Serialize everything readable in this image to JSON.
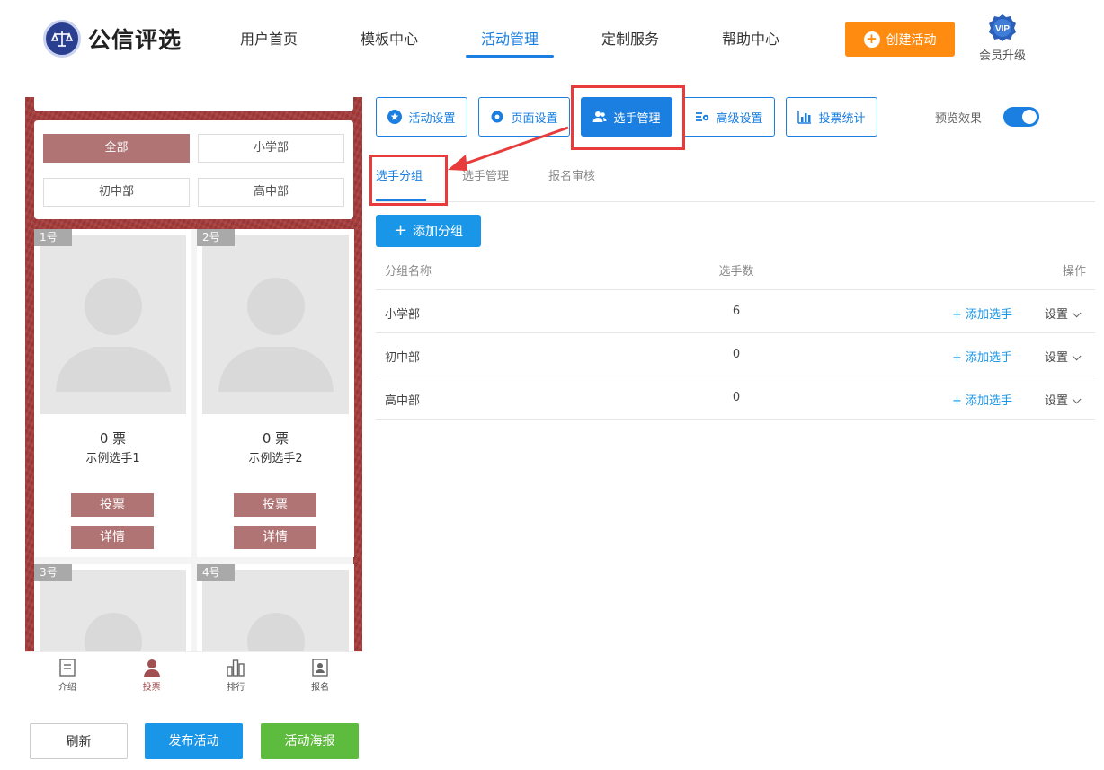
{
  "brand": {
    "name": "公信评选"
  },
  "nav": {
    "items": [
      "用户首页",
      "模板中心",
      "活动管理",
      "定制服务",
      "帮助中心"
    ],
    "active": "活动管理"
  },
  "header": {
    "create_label": "创建活动",
    "vip_badge": "VIP",
    "vip_label": "会员升级"
  },
  "preview": {
    "groups": [
      "全部",
      "小学部",
      "初中部",
      "高中部"
    ],
    "selected_group": "全部",
    "players": [
      {
        "num": "1号",
        "votes": "0 票",
        "name": "示例选手1",
        "vote_btn": "投票",
        "detail_btn": "详情"
      },
      {
        "num": "2号",
        "votes": "0 票",
        "name": "示例选手2",
        "vote_btn": "投票",
        "detail_btn": "详情"
      },
      {
        "num": "3号"
      },
      {
        "num": "4号"
      }
    ],
    "tabbar": [
      "介绍",
      "投票",
      "排行",
      "报名"
    ],
    "active_tab": "投票"
  },
  "actions": {
    "refresh": "刷新",
    "publish": "发布活动",
    "poster": "活动海报"
  },
  "toolbar": {
    "buttons": [
      "活动设置",
      "页面设置",
      "选手管理",
      "高级设置",
      "投票统计"
    ],
    "active": "选手管理",
    "preview_label": "预览效果",
    "preview_on": true
  },
  "subtabs": {
    "items": [
      "选手分组",
      "选手管理",
      "报名审核"
    ],
    "active": "选手分组"
  },
  "groups_panel": {
    "add_group": "添加分组",
    "columns": [
      "分组名称",
      "选手数",
      "操作"
    ],
    "rows": [
      {
        "name": "小学部",
        "count": "6"
      },
      {
        "name": "初中部",
        "count": "0"
      },
      {
        "name": "高中部",
        "count": "0"
      }
    ],
    "add_player": "添加选手",
    "settings": "设置"
  },
  "colors": {
    "accent": "#1a7fe0",
    "orange": "#ff8c10",
    "theme": "#a53a3a",
    "highlight": "#e83b3b",
    "green": "#5dbb3d"
  }
}
